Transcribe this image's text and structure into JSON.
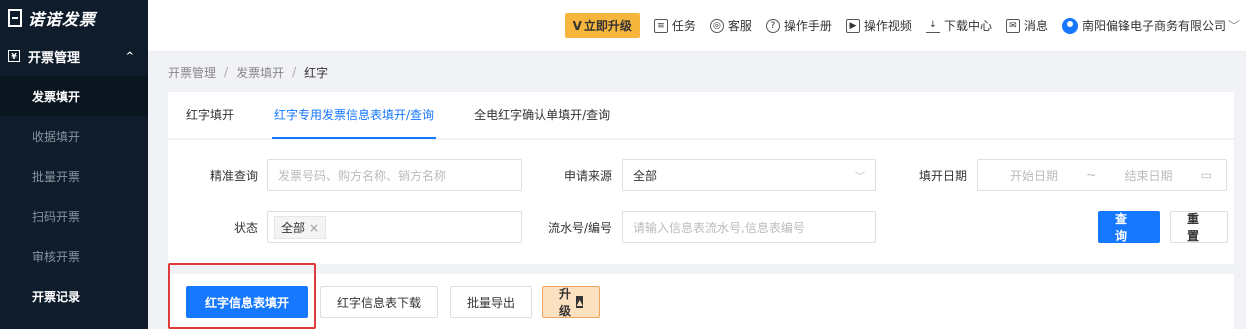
{
  "app": {
    "logo_text": "诺诺发票"
  },
  "sidebar": {
    "parent": {
      "label": "开票管理"
    },
    "items": [
      {
        "label": "发票填开",
        "state": "active"
      },
      {
        "label": "收据填开",
        "state": "normal"
      },
      {
        "label": "批量开票",
        "state": "normal"
      },
      {
        "label": "扫码开票",
        "state": "normal"
      },
      {
        "label": "审核开票",
        "state": "normal"
      },
      {
        "label": "开票记录",
        "state": "bold"
      }
    ]
  },
  "header": {
    "upgrade": "立即升级",
    "tasks": "任务",
    "service": "客服",
    "manual": "操作手册",
    "video": "操作视频",
    "download": "下载中心",
    "message": "消息",
    "company": "南阳偏锋电子商务有限公司"
  },
  "breadcrumb": [
    "开票管理",
    "发票填开",
    "红字"
  ],
  "tabs": [
    {
      "label": "红字填开"
    },
    {
      "label": "红字专用发票信息表填开/查询"
    },
    {
      "label": "全电红字确认单填开/查询"
    }
  ],
  "filters": {
    "exact": {
      "label": "精准查询",
      "placeholder": "发票号码、购方名称、销方名称"
    },
    "source": {
      "label": "申请来源",
      "value": "全部"
    },
    "date": {
      "label": "填开日期",
      "start": "开始日期",
      "tilde": "~",
      "end": "结束日期"
    },
    "status": {
      "label": "状态",
      "tag": "全部",
      "tag_close": "×"
    },
    "serial": {
      "label": "流水号/编号",
      "placeholder": "请输入信息表流水号,信息表编号"
    },
    "query_btn": "查 询",
    "reset_btn": "重 置"
  },
  "actions": {
    "fill": "红字信息表填开",
    "download": "红字信息表下载",
    "export": "批量导出",
    "upgrade": "升级"
  },
  "colors": {
    "primary": "#1677ff",
    "highlight": "#e03b3b",
    "sidebar": "#0f1c2b",
    "upgrade": "#f6b53d"
  }
}
